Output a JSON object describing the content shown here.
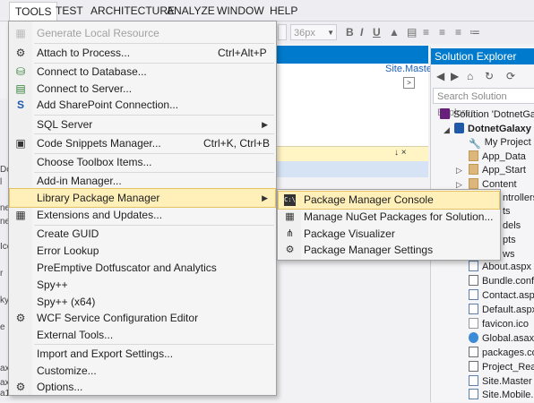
{
  "menubar": {
    "items": [
      "TOOLS",
      "TEST",
      "ARCHITECTURE",
      "ANALYZE",
      "WINDOW",
      "HELP"
    ],
    "active": "TOOLS"
  },
  "toolbar": {
    "font_size_value": "36px",
    "buttons": [
      "B",
      "I",
      "U"
    ]
  },
  "editor": {
    "tab_label": "Site.Master",
    "panel_pin": "↓ ×"
  },
  "left_fragments": [
    "Dot",
    "l",
    "ne",
    "ne",
    "Ice",
    "r",
    "ky",
    "e",
    "axo",
    "ax",
    "a1"
  ],
  "tools_menu": {
    "items": [
      {
        "label": "Generate Local Resource",
        "shortcut": "",
        "disabled": true,
        "submenu": false,
        "icon": ""
      },
      {
        "label": "Attach to Process...",
        "shortcut": "Ctrl+Alt+P",
        "disabled": false,
        "submenu": false,
        "icon": "attach-icon"
      },
      {
        "label": "Connect to Database...",
        "shortcut": "",
        "disabled": false,
        "submenu": false,
        "icon": "database-icon"
      },
      {
        "label": "Connect to Server...",
        "shortcut": "",
        "disabled": false,
        "submenu": false,
        "icon": "server-icon"
      },
      {
        "label": "Add SharePoint Connection...",
        "shortcut": "",
        "disabled": false,
        "submenu": false,
        "icon": "sharepoint-icon"
      },
      {
        "label": "SQL Server",
        "shortcut": "",
        "disabled": false,
        "submenu": true,
        "icon": ""
      },
      {
        "label": "Code Snippets Manager...",
        "shortcut": "Ctrl+K, Ctrl+B",
        "disabled": false,
        "submenu": false,
        "icon": "snippets-icon"
      },
      {
        "label": "Choose Toolbox Items...",
        "shortcut": "",
        "disabled": false,
        "submenu": false,
        "icon": ""
      },
      {
        "label": "Add-in Manager...",
        "shortcut": "",
        "disabled": false,
        "submenu": false,
        "icon": ""
      },
      {
        "label": "Library Package Manager",
        "shortcut": "",
        "disabled": false,
        "submenu": true,
        "icon": "",
        "highlighted": true
      },
      {
        "label": "Extensions and Updates...",
        "shortcut": "",
        "disabled": false,
        "submenu": false,
        "icon": "extensions-icon"
      },
      {
        "label": "Create GUID",
        "shortcut": "",
        "disabled": false,
        "submenu": false,
        "icon": ""
      },
      {
        "label": "Error Lookup",
        "shortcut": "",
        "disabled": false,
        "submenu": false,
        "icon": ""
      },
      {
        "label": "PreEmptive Dotfuscator and Analytics",
        "shortcut": "",
        "disabled": false,
        "submenu": false,
        "icon": ""
      },
      {
        "label": "Spy++",
        "shortcut": "",
        "disabled": false,
        "submenu": false,
        "icon": ""
      },
      {
        "label": "Spy++ (x64)",
        "shortcut": "",
        "disabled": false,
        "submenu": false,
        "icon": ""
      },
      {
        "label": "WCF Service Configuration Editor",
        "shortcut": "",
        "disabled": false,
        "submenu": false,
        "icon": "wcf-gear-icon"
      },
      {
        "label": "External Tools...",
        "shortcut": "",
        "disabled": false,
        "submenu": false,
        "icon": ""
      },
      {
        "label": "Import and Export Settings...",
        "shortcut": "",
        "disabled": false,
        "submenu": false,
        "icon": ""
      },
      {
        "label": "Customize...",
        "shortcut": "",
        "disabled": false,
        "submenu": false,
        "icon": ""
      },
      {
        "label": "Options...",
        "shortcut": "",
        "disabled": false,
        "submenu": false,
        "icon": "options-gear-icon"
      }
    ]
  },
  "package_submenu": {
    "items": [
      {
        "label": "Package Manager Console",
        "icon": "console-icon",
        "highlighted": true
      },
      {
        "label": "Manage NuGet Packages for Solution...",
        "icon": "nuget-icon"
      },
      {
        "label": "Package Visualizer",
        "icon": "visualizer-icon"
      },
      {
        "label": "Package Manager Settings",
        "icon": "settings-gear-icon"
      }
    ]
  },
  "solution_explorer": {
    "title": "Solution Explorer",
    "search_placeholder": "Search Solution Explorer",
    "items": [
      "Solution 'DotnetGal",
      "DotnetGalaxy",
      "My Project",
      "App_Data",
      "App_Start",
      "Content",
      "ntrollers",
      "ts",
      "dels",
      "pts",
      "ws",
      "About.aspx",
      "Bundle.confi",
      "Contact.aspx",
      "Default.aspx",
      "favicon.ico",
      "Global.asax",
      "packages.co",
      "Project_Read",
      "Site.Master",
      "Site.Mobile.M"
    ]
  }
}
